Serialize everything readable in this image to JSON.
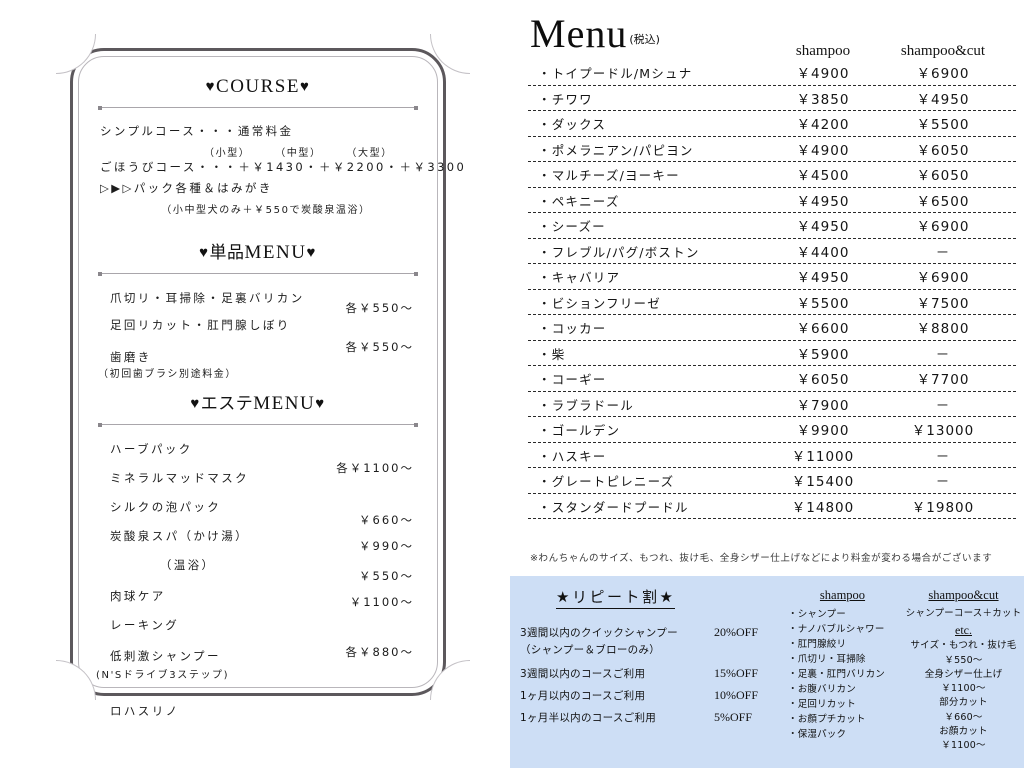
{
  "left_panel": {
    "course": {
      "heading": "COURSE",
      "lines": [
        "シンプルコース・・・通常料金",
        "（小型）　　　（中型）　　　（大型）",
        "ごほうびコース・・・＋￥1430・＋￥2200・＋￥3300",
        "▷▶▷パック各種＆はみがき"
      ],
      "note": "（小中型犬のみ＋￥550で炭酸泉温浴）"
    },
    "tanpin": {
      "heading_jp": "単品",
      "heading_en": "MENU",
      "rows": [
        {
          "name": "爪切リ・耳掃除・足裏バリカン",
          "price": ""
        },
        {
          "name": "足回リカット・肛門腺しぼり",
          "price": "各￥550～"
        },
        {
          "name": "歯磨き",
          "price": "各￥550～"
        },
        {
          "name": "（初回歯ブラシ別途料金）",
          "price": ""
        }
      ],
      "group_price_1": "各￥550～",
      "group_price_2": "各￥550～"
    },
    "este": {
      "heading_jp": "エステ",
      "heading_en": "MENU",
      "rows": [
        {
          "name": "ハーブパック",
          "price": ""
        },
        {
          "name": "ミネラルマッドマスク",
          "price": "各￥1100～"
        },
        {
          "name": "シルクの泡パック",
          "price": ""
        },
        {
          "name": "炭酸泉スパ（かけ湯）",
          "price": "￥660～"
        },
        {
          "name": "　　　　（温浴）",
          "price": "￥990～"
        },
        {
          "name": "肉球ケア",
          "price": "￥550～"
        },
        {
          "name": "レーキング",
          "price": "￥1100～"
        },
        {
          "name": "低刺激シャンプー",
          "price": ""
        },
        {
          "name": "(N'Sドライブ3ステップ)",
          "price": "各￥880～"
        },
        {
          "name": "ロハスリノ",
          "price": ""
        }
      ]
    }
  },
  "right_panel": {
    "title": "Menu",
    "tax_note": "(税込)",
    "columns": {
      "name": "",
      "shampoo": "shampoo",
      "shampoo_cut": "shampoo&cut"
    },
    "rows": [
      {
        "name": "・トイプードル/Mシュナ",
        "shampoo": "￥4900",
        "shampoo_cut": "￥6900"
      },
      {
        "name": "・チワワ",
        "shampoo": "￥3850",
        "shampoo_cut": "￥4950"
      },
      {
        "name": "・ダックス",
        "shampoo": "￥4200",
        "shampoo_cut": "￥5500"
      },
      {
        "name": "・ポメラニアン/パピヨン",
        "shampoo": "￥4900",
        "shampoo_cut": "￥6050"
      },
      {
        "name": "・マルチーズ/ヨーキー",
        "shampoo": "￥4500",
        "shampoo_cut": "￥6050"
      },
      {
        "name": "・ペキニーズ",
        "shampoo": "￥4950",
        "shampoo_cut": "￥6500"
      },
      {
        "name": "・シーズー",
        "shampoo": "￥4950",
        "shampoo_cut": "￥6900"
      },
      {
        "name": "・フレブル/パグ/ボストン",
        "shampoo": "￥4400",
        "shampoo_cut": "－"
      },
      {
        "name": "・キャバリア",
        "shampoo": "￥4950",
        "shampoo_cut": "￥6900"
      },
      {
        "name": "・ビションフリーゼ",
        "shampoo": "￥5500",
        "shampoo_cut": "￥7500"
      },
      {
        "name": "・コッカー",
        "shampoo": "￥6600",
        "shampoo_cut": "￥8800"
      },
      {
        "name": "・柴",
        "shampoo": "￥5900",
        "shampoo_cut": "－"
      },
      {
        "name": "・コーギー",
        "shampoo": "￥6050",
        "shampoo_cut": "￥7700"
      },
      {
        "name": "・ラブラドール",
        "shampoo": "￥7900",
        "shampoo_cut": "－"
      },
      {
        "name": "・ゴールデン",
        "shampoo": "￥9900",
        "shampoo_cut": "￥13000"
      },
      {
        "name": "・ハスキー",
        "shampoo": "￥11000",
        "shampoo_cut": "－"
      },
      {
        "name": "・グレートピレニーズ",
        "shampoo": "￥15400",
        "shampoo_cut": "－"
      },
      {
        "name": "・スタンダードプードル",
        "shampoo": "￥14800",
        "shampoo_cut": "￥19800"
      }
    ],
    "note": "※わんちゃんのサイズ、もつれ、抜け毛、全身シザー仕上げなどにより料金が変わる場合がございます"
  },
  "repeat_box": {
    "background_color": "#cddef5",
    "title": "★リピート割★",
    "discounts": [
      {
        "label": "3週間以内のクイックシャンプー",
        "sub": "（シャンプー＆ブローのみ）",
        "off": "20%OFF"
      },
      {
        "label": "3週間以内のコースご利用",
        "sub": "",
        "off": "15%OFF"
      },
      {
        "label": "1ヶ月以内のコースご利用",
        "sub": "",
        "off": "10%OFF"
      },
      {
        "label": "1ヶ月半以内のコースご利用",
        "sub": "",
        "off": "5%OFF"
      }
    ],
    "shampoo_col": {
      "head": "shampoo",
      "items": [
        "・シャンプー",
        "・ナノバブルシャワー",
        "・肛門腺絞リ",
        "・爪切リ・耳掃除",
        "・足裏・肛門バリカン",
        "・お腹バリカン",
        "・足回リカット",
        "・お顔プチカット",
        "・保湿パック"
      ]
    },
    "cut_col": {
      "head": "shampoo&cut",
      "lead": "シャンプーコース＋カット",
      "etc_head": "etc.",
      "items": [
        "サイズ・もつれ・抜け毛",
        "￥550～",
        "全身シザー仕上げ",
        "￥1100～",
        "部分カット",
        "￥660～",
        "お顔カット",
        "￥1100～"
      ]
    }
  }
}
